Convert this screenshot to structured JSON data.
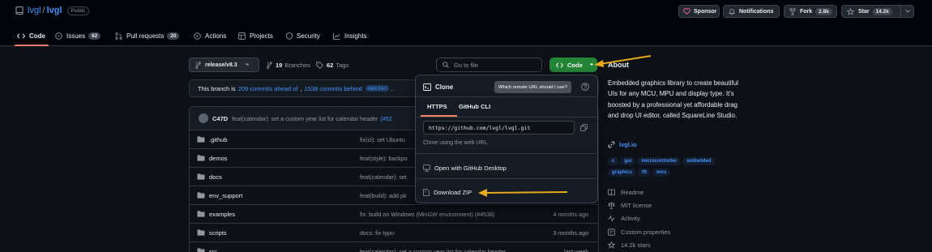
{
  "repo": {
    "owner": "lvgl",
    "separator": "/",
    "name": "lvgl",
    "visibility": "Public"
  },
  "header_actions": {
    "sponsor": "Sponsor",
    "notifications": "Notifications",
    "fork": "Fork",
    "fork_count": "2.8k",
    "star": "Star",
    "star_count": "14.2k"
  },
  "tabs": [
    {
      "label": "Code",
      "icon": "code-icon"
    },
    {
      "label": "Issues",
      "count": "62",
      "icon": "issue-icon"
    },
    {
      "label": "Pull requests",
      "count": "20",
      "icon": "pull-request-icon"
    },
    {
      "label": "Actions",
      "icon": "play-icon"
    },
    {
      "label": "Projects",
      "icon": "table-icon"
    },
    {
      "label": "Security",
      "icon": "shield-icon"
    },
    {
      "label": "Insights",
      "icon": "graph-icon"
    }
  ],
  "toolbar": {
    "branch": "release/v8.3",
    "branches_count": "19",
    "branches_label": "Branches",
    "tags_count": "62",
    "tags_label": "Tags",
    "search_placeholder": "Go to file",
    "code_button": "Code"
  },
  "branch_status": {
    "prefix": "This branch is",
    "ahead": "209 commits ahead of",
    "comma": ",",
    "behind": "1538 commits behind",
    "base": "master",
    "suffix": "."
  },
  "latest_commit": {
    "author": "C47D",
    "message": "feat(calendar): set a custom year list for calendar header",
    "pr_ref": "(#52"
  },
  "files": [
    {
      "name": ".github",
      "message": "fix(ci): set Ubuntu",
      "date": ""
    },
    {
      "name": "demos",
      "message": "feat(style): backpo",
      "date": ""
    },
    {
      "name": "docs",
      "message": "feat(calendar): set",
      "date": ""
    },
    {
      "name": "env_support",
      "message": "feat(build): add pk",
      "date": ""
    },
    {
      "name": "examples",
      "message": "fix: build on Windows (MinGW environment) (#4538)",
      "date": "4 months ago"
    },
    {
      "name": "scripts",
      "message": "docs: fix typo",
      "date": "3 months ago"
    },
    {
      "name": "src",
      "message": "feat(calendar): set a custom year list for calendar header",
      "date": "last week"
    }
  ],
  "clone_popover": {
    "title": "Clone",
    "tooltip": "Which remote URL should I use?",
    "tab_https": "HTTPS",
    "tab_cli": "GitHub CLI",
    "url": "https://github.com/lvgl/lvgl.git",
    "hint": "Clone using the web URL.",
    "desktop": "Open with GitHub Desktop",
    "zip": "Download ZIP"
  },
  "about": {
    "title": "About",
    "description": "Embedded graphics library to create beautiful UIs for any MCU, MPU and display type. It's boosted by a professional yet affordable drag and drop UI editor, called SquareLine Studio.",
    "website": "lvgl.io",
    "topics": [
      "c",
      "gui",
      "microcontroller",
      "embedded",
      "graphics",
      "tft",
      "mcu"
    ],
    "readme": "Readme",
    "license": "MIT license",
    "activity": "Activity",
    "custom_properties": "Custom properties",
    "stars": "14.2k stars"
  },
  "colors": {
    "accent_green": "#238636",
    "annotation_arrow": "#e6a91a",
    "link_blue": "#4493f8",
    "tab_underline": "#f78166"
  }
}
